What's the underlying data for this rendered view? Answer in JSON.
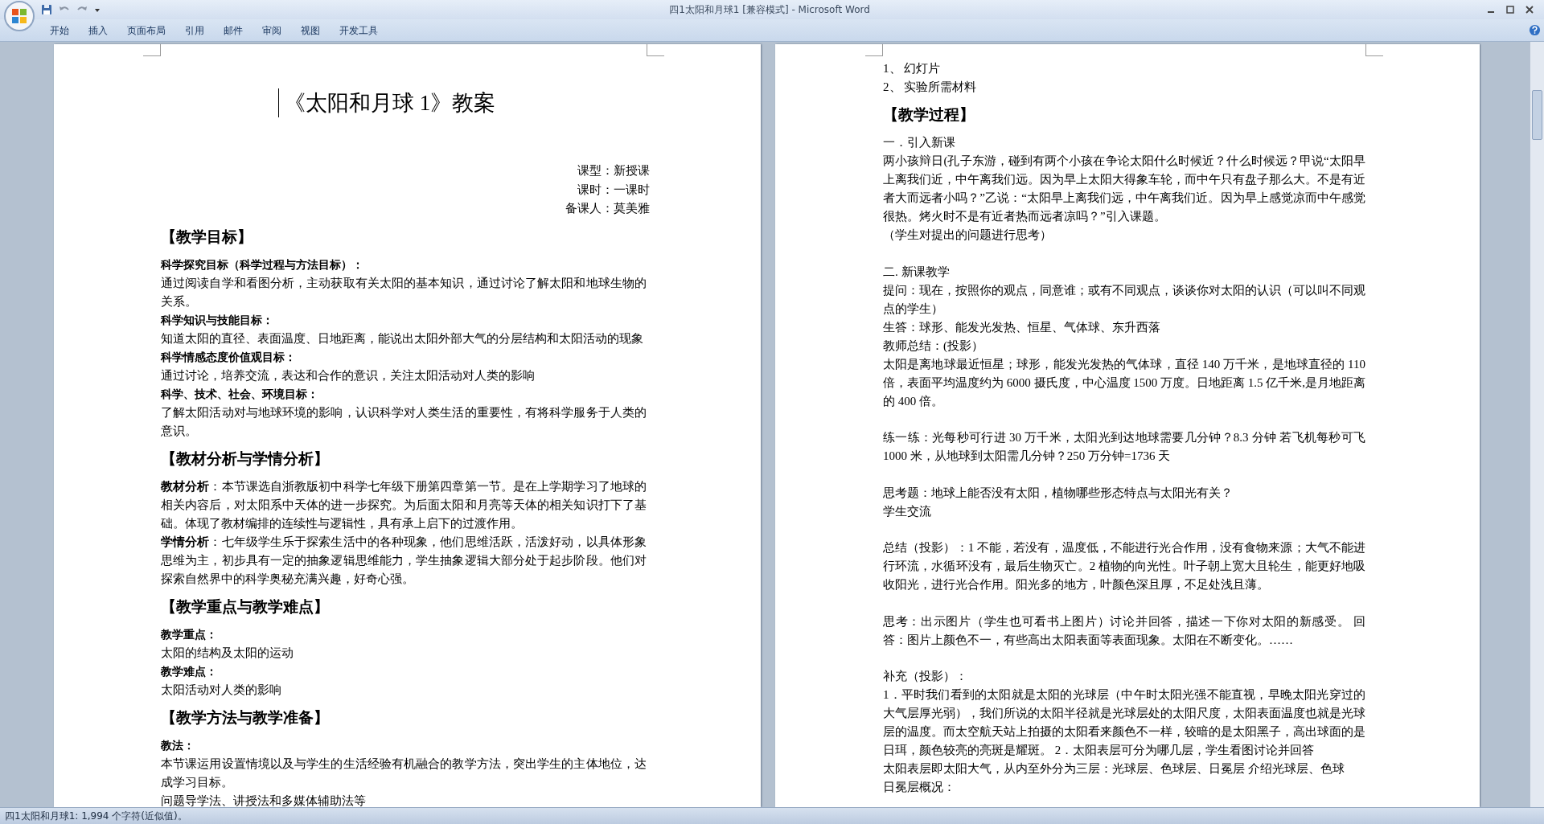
{
  "window": {
    "title": "四1太阳和月球1 [兼容模式] - Microsoft Word"
  },
  "ribbon_tabs": [
    "开始",
    "插入",
    "页面布局",
    "引用",
    "邮件",
    "审阅",
    "视图",
    "开发工具"
  ],
  "pages": [
    {
      "blocks": [
        {
          "kind": "title",
          "text": "《太阳和月球 1》教案"
        },
        {
          "kind": "meta",
          "text": "课型：新授课"
        },
        {
          "kind": "meta",
          "text": "课时：一课时"
        },
        {
          "kind": "meta",
          "text": "备课人：莫美雅"
        },
        {
          "kind": "heading",
          "text": "【教学目标】"
        },
        {
          "kind": "label",
          "text": "科学探究目标（科学过程与方法目标）："
        },
        {
          "kind": "para",
          "text": "通过阅读自学和看图分析，主动获取有关太阳的基本知识，通过讨论了解太阳和地球生物的关系。"
        },
        {
          "kind": "label",
          "text": "科学知识与技能目标："
        },
        {
          "kind": "para",
          "text": "知道太阳的直径、表面温度、日地距离，能说出太阳外部大气的分层结构和太阳活动的现象"
        },
        {
          "kind": "label",
          "text": "科学情感态度价值观目标："
        },
        {
          "kind": "para",
          "text": "通过讨论，培养交流，表达和合作的意识，关注太阳活动对人类的影响"
        },
        {
          "kind": "label",
          "text": "科学、技术、社会、环境目标："
        },
        {
          "kind": "para",
          "text": "了解太阳活动对与地球环境的影响，认识科学对人类生活的重要性，有将科学服务于人类的意识。"
        },
        {
          "kind": "heading",
          "text": "【教材分析与学情分析】"
        },
        {
          "kind": "para",
          "text": "**教材分析**：本节课选自浙教版初中科学七年级下册第四章第一节。是在上学期学习了地球的相关内容后，对太阳系中天体的进一步探究。为后面太阳和月亮等天体的相关知识打下了基础。体现了教材编排的连续性与逻辑性，具有承上启下的过渡作用。"
        },
        {
          "kind": "para",
          "text": "**学情分析**：七年级学生乐于探索生活中的各种现象，他们思维活跃，活泼好动，以具体形象思维为主，初步具有一定的抽象逻辑思维能力，学生抽象逻辑大部分处于起步阶段。他们对探索自然界中的科学奥秘充满兴趣，好奇心强。"
        },
        {
          "kind": "heading",
          "text": "【教学重点与教学难点】"
        },
        {
          "kind": "label",
          "text": "教学重点："
        },
        {
          "kind": "para",
          "text": "太阳的结构及太阳的运动"
        },
        {
          "kind": "label",
          "text": "教学难点："
        },
        {
          "kind": "para",
          "text": "太阳活动对人类的影响"
        },
        {
          "kind": "heading",
          "text": "【教学方法与教学准备】"
        },
        {
          "kind": "label",
          "text": "教法："
        },
        {
          "kind": "para",
          "text": "本节课运用设置情境以及与学生的生活经验有机融合的教学方法，突出学生的主体地位，达成学习目标。"
        },
        {
          "kind": "para",
          "text": "问题导学法、讲授法和多媒体辅助法等"
        }
      ]
    },
    {
      "blocks": [
        {
          "kind": "para",
          "text": "1、 幻灯片"
        },
        {
          "kind": "para",
          "text": "2、 实验所需材料"
        },
        {
          "kind": "heading",
          "text": "【教学过程】"
        },
        {
          "kind": "para",
          "text": "一．引入新课"
        },
        {
          "kind": "para",
          "text": "两小孩辩日(孔子东游，碰到有两个小孩在争论太阳什么时候近？什么时候远？甲说“太阳早上离我们近，中午离我们远。因为早上太阳大得象车轮，而中午只有盘子那么大。不是有近者大而远者小吗？”乙说：“太阳早上离我们远，中午离我们近。因为早上感觉凉而中午感觉很热。烤火时不是有近者热而远者凉吗？”引入课题。"
        },
        {
          "kind": "para",
          "text": "（学生对提出的问题进行思考）"
        },
        {
          "kind": "blank"
        },
        {
          "kind": "para",
          "text": "二. 新课教学"
        },
        {
          "kind": "para",
          "text": "提问：现在，按照你的观点，同意谁；或有不同观点，谈谈你对太阳的认识（可以叫不同观点的学生）"
        },
        {
          "kind": "para",
          "text": "生答：球形、能发光发热、恒星、气体球、东升西落"
        },
        {
          "kind": "para",
          "text": "教师总结：(投影）"
        },
        {
          "kind": "para",
          "text": "太阳是离地球最近恒星；球形，能发光发热的气体球，直径 140 万千米，是地球直径的 110 倍，表面平均温度约为 6000 摄氏度，中心温度 1500 万度。日地距离 1.5 亿千米,是月地距离的 400 倍。"
        },
        {
          "kind": "blank"
        },
        {
          "kind": "para",
          "text": "练一练：光每秒可行进 30 万千米，太阳光到达地球需要几分钟？8.3 分钟  若飞机每秒可飞 1000 米，从地球到太阳需几分钟？250 万分钟=1736 天"
        },
        {
          "kind": "blank"
        },
        {
          "kind": "para",
          "text": "思考题：地球上能否没有太阳，植物哪些形态特点与太阳光有关？"
        },
        {
          "kind": "para",
          "text": "学生交流"
        },
        {
          "kind": "blank"
        },
        {
          "kind": "para",
          "text": " 总结（投影）：1 不能，若没有，温度低，不能进行光合作用，没有食物来源；大气不能进行环流，水循环没有，最后生物灭亡。2 植物的向光性。叶子朝上宽大且轮生，能更好地吸收阳光，进行光合作用。阳光多的地方，叶颜色深且厚，不足处浅且薄。"
        },
        {
          "kind": "blank"
        },
        {
          "kind": "para",
          "text": "思考：出示图片（学生也可看书上图片）讨论并回答，描述一下你对太阳的新感受。 回答：图片上颜色不一，有些高出太阳表面等表面现象。太阳在不断变化。……"
        },
        {
          "kind": "blank"
        },
        {
          "kind": "para",
          "text": "补充（投影）："
        },
        {
          "kind": "para",
          "text": "1．平时我们看到的太阳就是太阳的光球层（中午时太阳光强不能直视，早晚太阳光穿过的大气层厚光弱），我们所说的太阳半径就是光球层处的太阳尺度，太阳表面温度也就是光球层的温度。而太空航天站上拍摄的太阳看来颜色不一样，较暗的是太阳黑子，高出球面的是日珥，颜色较亮的亮斑是耀斑。 2．太阳表层可分为哪几层，学生看图讨论并回答"
        },
        {
          "kind": "para",
          "text": "太阳表层即太阳大气，从内至外分为三层：光球层、色球层、日冕层 介绍光球层、色球"
        },
        {
          "kind": "para",
          "text": "日冕层概况："
        }
      ]
    }
  ],
  "status_bar": {
    "text": "四1太阳和月球1: 1,994 个字符(近似值)。"
  }
}
